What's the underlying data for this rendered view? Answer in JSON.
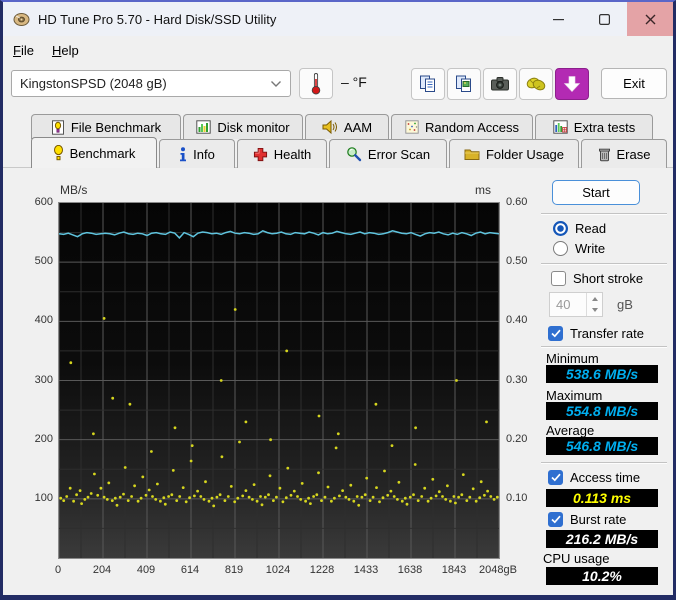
{
  "window": {
    "title": "HD Tune Pro 5.70 - Hard Disk/SSD Utility"
  },
  "menu": {
    "items": [
      "File",
      "Help"
    ]
  },
  "toolbar": {
    "drive_select": "KingstonSPSD (2048 gB)",
    "temperature": "– °F",
    "exit_label": "Exit"
  },
  "tabs": {
    "row1": [
      {
        "label": "File Benchmark"
      },
      {
        "label": "Disk monitor"
      },
      {
        "label": "AAM"
      },
      {
        "label": "Random Access"
      },
      {
        "label": "Extra tests"
      }
    ],
    "row2": [
      {
        "label": "Benchmark"
      },
      {
        "label": "Info"
      },
      {
        "label": "Health"
      },
      {
        "label": "Error Scan"
      },
      {
        "label": "Folder Usage"
      },
      {
        "label": "Erase"
      }
    ],
    "active": "Benchmark"
  },
  "controls": {
    "start_label": "Start",
    "read_label": "Read",
    "write_label": "Write",
    "short_stroke_label": "Short stroke",
    "short_stroke_value": "40",
    "short_stroke_unit": "gB",
    "transfer_rate_label": "Transfer rate",
    "minimum_label": "Minimum",
    "minimum_value": "538.6 MB/s",
    "maximum_label": "Maximum",
    "maximum_value": "554.8 MB/s",
    "average_label": "Average",
    "average_value": "546.8 MB/s",
    "access_time_label": "Access time",
    "access_time_value": "0.113 ms",
    "burst_rate_label": "Burst rate",
    "burst_rate_value": "216.2 MB/s",
    "cpu_usage_label": "CPU usage",
    "cpu_usage_value": "10.2%"
  },
  "chart_data": [
    {
      "type": "line",
      "name": "transfer-rate",
      "title": "",
      "xlabel": "gB",
      "ylabel": "MB/s",
      "x_range": [
        0,
        2048
      ],
      "ylim": [
        0,
        600
      ],
      "grid": true,
      "color": "#5fc4de",
      "x_ticks": [
        [
          0,
          "0"
        ],
        [
          204.8,
          "204"
        ],
        [
          409.6,
          "409"
        ],
        [
          614.4,
          "614"
        ],
        [
          819.2,
          "819"
        ],
        [
          1024,
          "1024"
        ],
        [
          1228.8,
          "1228"
        ],
        [
          1433.6,
          "1433"
        ],
        [
          1638.4,
          "1638"
        ],
        [
          1843.2,
          "1843"
        ],
        [
          2048,
          "2048gB"
        ]
      ],
      "y_ticks": [
        [
          600,
          "600"
        ],
        [
          500,
          "500"
        ],
        [
          400,
          "400"
        ],
        [
          300,
          "300"
        ],
        [
          200,
          "200"
        ],
        [
          100,
          "100"
        ]
      ],
      "y_unit_label": "MB/s",
      "values": [
        548,
        547,
        549,
        546,
        543,
        548,
        550,
        549,
        547,
        548,
        549,
        548,
        546,
        549,
        551,
        548,
        547,
        549,
        548,
        545,
        549,
        550,
        548,
        547,
        551,
        549,
        541,
        550,
        547,
        543,
        549,
        551,
        550,
        548,
        549,
        547,
        550,
        552,
        549,
        548,
        550,
        549,
        547,
        548,
        553,
        550,
        548,
        549,
        551,
        548,
        547,
        550,
        549,
        548,
        551,
        549,
        546,
        550,
        548,
        549,
        552,
        550,
        548,
        547,
        549,
        551,
        548,
        550,
        549,
        547,
        548,
        550,
        553,
        551,
        549,
        548,
        550,
        547,
        544,
        548,
        550,
        549,
        551,
        548,
        546,
        549,
        547,
        550,
        548,
        545,
        549,
        551,
        548,
        550,
        549,
        548
      ]
    },
    {
      "type": "scatter",
      "name": "access-time",
      "ylabel": "ms",
      "ylim": [
        0,
        0.6
      ],
      "color": "#d6d61e",
      "y_ticks": [
        [
          0.6,
          "0.60"
        ],
        [
          0.5,
          "0.50"
        ],
        [
          0.4,
          "0.40"
        ],
        [
          0.3,
          "0.30"
        ],
        [
          0.2,
          "0.20"
        ],
        [
          0.1,
          "0.10"
        ]
      ],
      "y_unit_label": "ms",
      "points": [
        [
          8,
          0.101
        ],
        [
          22,
          0.097
        ],
        [
          36,
          0.104
        ],
        [
          52,
          0.118
        ],
        [
          68,
          0.096
        ],
        [
          82,
          0.107
        ],
        [
          98,
          0.114
        ],
        [
          105,
          0.092
        ],
        [
          120,
          0.099
        ],
        [
          135,
          0.103
        ],
        [
          150,
          0.109
        ],
        [
          165,
          0.142
        ],
        [
          180,
          0.106
        ],
        [
          195,
          0.118
        ],
        [
          210,
          0.103
        ],
        [
          225,
          0.099
        ],
        [
          232,
          0.127
        ],
        [
          248,
          0.097
        ],
        [
          262,
          0.101
        ],
        [
          270,
          0.089
        ],
        [
          285,
          0.103
        ],
        [
          300,
          0.108
        ],
        [
          308,
          0.153
        ],
        [
          322,
          0.097
        ],
        [
          338,
          0.104
        ],
        [
          352,
          0.122
        ],
        [
          368,
          0.096
        ],
        [
          382,
          0.101
        ],
        [
          390,
          0.137
        ],
        [
          405,
          0.106
        ],
        [
          420,
          0.115
        ],
        [
          435,
          0.104
        ],
        [
          450,
          0.099
        ],
        [
          458,
          0.125
        ],
        [
          472,
          0.096
        ],
        [
          488,
          0.102
        ],
        [
          495,
          0.091
        ],
        [
          510,
          0.104
        ],
        [
          525,
          0.107
        ],
        [
          532,
          0.148
        ],
        [
          548,
          0.097
        ],
        [
          562,
          0.104
        ],
        [
          578,
          0.119
        ],
        [
          592,
          0.095
        ],
        [
          608,
          0.102
        ],
        [
          615,
          0.164
        ],
        [
          630,
          0.105
        ],
        [
          645,
          0.113
        ],
        [
          660,
          0.104
        ],
        [
          675,
          0.099
        ],
        [
          682,
          0.129
        ],
        [
          698,
          0.096
        ],
        [
          712,
          0.101
        ],
        [
          720,
          0.088
        ],
        [
          735,
          0.103
        ],
        [
          750,
          0.107
        ],
        [
          758,
          0.171
        ],
        [
          772,
          0.097
        ],
        [
          788,
          0.104
        ],
        [
          802,
          0.121
        ],
        [
          818,
          0.095
        ],
        [
          832,
          0.101
        ],
        [
          840,
          0.196
        ],
        [
          855,
          0.105
        ],
        [
          870,
          0.114
        ],
        [
          885,
          0.103
        ],
        [
          900,
          0.099
        ],
        [
          908,
          0.124
        ],
        [
          922,
          0.096
        ],
        [
          938,
          0.104
        ],
        [
          945,
          0.09
        ],
        [
          960,
          0.103
        ],
        [
          975,
          0.107
        ],
        [
          982,
          0.139
        ],
        [
          998,
          0.097
        ],
        [
          1012,
          0.103
        ],
        [
          1028,
          0.118
        ],
        [
          1042,
          0.095
        ],
        [
          1058,
          0.102
        ],
        [
          1065,
          0.152
        ],
        [
          1080,
          0.106
        ],
        [
          1095,
          0.113
        ],
        [
          1110,
          0.104
        ],
        [
          1125,
          0.099
        ],
        [
          1132,
          0.126
        ],
        [
          1148,
          0.096
        ],
        [
          1162,
          0.101
        ],
        [
          1170,
          0.092
        ],
        [
          1185,
          0.104
        ],
        [
          1200,
          0.107
        ],
        [
          1208,
          0.144
        ],
        [
          1222,
          0.097
        ],
        [
          1238,
          0.103
        ],
        [
          1252,
          0.12
        ],
        [
          1268,
          0.096
        ],
        [
          1282,
          0.101
        ],
        [
          1290,
          0.186
        ],
        [
          1305,
          0.105
        ],
        [
          1320,
          0.114
        ],
        [
          1335,
          0.103
        ],
        [
          1350,
          0.099
        ],
        [
          1358,
          0.123
        ],
        [
          1372,
          0.096
        ],
        [
          1388,
          0.104
        ],
        [
          1395,
          0.089
        ],
        [
          1410,
          0.103
        ],
        [
          1425,
          0.107
        ],
        [
          1432,
          0.135
        ],
        [
          1448,
          0.097
        ],
        [
          1462,
          0.103
        ],
        [
          1478,
          0.119
        ],
        [
          1492,
          0.095
        ],
        [
          1508,
          0.102
        ],
        [
          1515,
          0.147
        ],
        [
          1530,
          0.106
        ],
        [
          1545,
          0.113
        ],
        [
          1560,
          0.104
        ],
        [
          1575,
          0.099
        ],
        [
          1582,
          0.128
        ],
        [
          1598,
          0.096
        ],
        [
          1612,
          0.101
        ],
        [
          1620,
          0.091
        ],
        [
          1635,
          0.103
        ],
        [
          1650,
          0.107
        ],
        [
          1658,
          0.158
        ],
        [
          1672,
          0.097
        ],
        [
          1688,
          0.104
        ],
        [
          1702,
          0.118
        ],
        [
          1718,
          0.096
        ],
        [
          1732,
          0.101
        ],
        [
          1740,
          0.133
        ],
        [
          1755,
          0.105
        ],
        [
          1770,
          0.112
        ],
        [
          1785,
          0.104
        ],
        [
          1800,
          0.099
        ],
        [
          1808,
          0.122
        ],
        [
          1822,
          0.096
        ],
        [
          1838,
          0.104
        ],
        [
          1845,
          0.093
        ],
        [
          1860,
          0.103
        ],
        [
          1875,
          0.107
        ],
        [
          1882,
          0.141
        ],
        [
          1898,
          0.097
        ],
        [
          1912,
          0.103
        ],
        [
          1928,
          0.117
        ],
        [
          1942,
          0.096
        ],
        [
          1958,
          0.102
        ],
        [
          1965,
          0.129
        ],
        [
          1980,
          0.106
        ],
        [
          1995,
          0.113
        ],
        [
          2010,
          0.104
        ],
        [
          2025,
          0.099
        ],
        [
          2040,
          0.103
        ],
        [
          55,
          0.33
        ],
        [
          160,
          0.21
        ],
        [
          210,
          0.405
        ],
        [
          250,
          0.27
        ],
        [
          330,
          0.26
        ],
        [
          430,
          0.18
        ],
        [
          540,
          0.22
        ],
        [
          620,
          0.19
        ],
        [
          755,
          0.3
        ],
        [
          820,
          0.42
        ],
        [
          870,
          0.23
        ],
        [
          985,
          0.2
        ],
        [
          1060,
          0.35
        ],
        [
          1210,
          0.24
        ],
        [
          1300,
          0.21
        ],
        [
          1475,
          0.26
        ],
        [
          1550,
          0.19
        ],
        [
          1660,
          0.22
        ],
        [
          1850,
          0.3
        ],
        [
          1990,
          0.23
        ]
      ]
    }
  ]
}
